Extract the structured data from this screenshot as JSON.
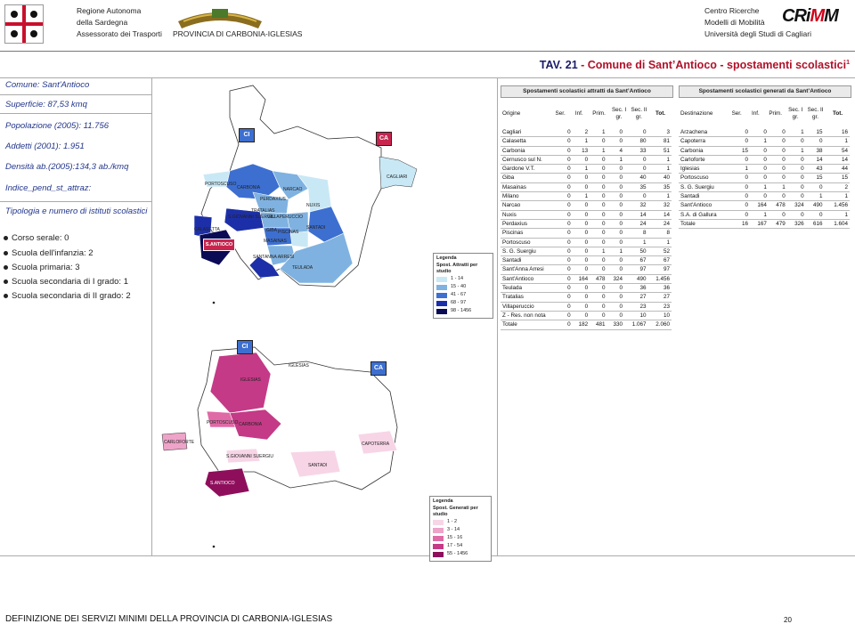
{
  "header": {
    "left": [
      "Regione Autonoma",
      "della Sardegna",
      "Assessorato dei Trasporti"
    ],
    "province": "PROVINCIA DI CARBONIA-IGLESIAS",
    "right": [
      "Centro Ricerche",
      "Modelli di Mobilità",
      "Università degli Studi di Cagliari"
    ],
    "logo": {
      "pre": "CRi",
      "mid": "M",
      "post": "M"
    }
  },
  "title": {
    "prefix": "TAV. 21",
    "text": " - Comune di Sant’Antioco - spostamenti scolastici",
    "sup": "1"
  },
  "left_panel": {
    "comune": "Comune: Sant'Antioco",
    "superficie": "Superficie: 87,53 kmq",
    "popolazione": "Popolazione (2005): 11.756",
    "addetti": "Addetti (2001): 1.951",
    "densita": "Densità ab.(2005):134,3 ab./kmq",
    "indice": "Indice_pend_st_attraz:",
    "tipologia": "Tipologia e numero di istituti scolastici",
    "istituti": [
      "Corso serale: 0",
      "Scuola dell'infanzia: 2",
      "Scuola primaria: 3",
      "Scuola secondaria di I grado: 1",
      "Scuola secondaria di II grado: 2"
    ]
  },
  "tables": {
    "attratti": {
      "title": "Spostamenti scolastici attratti da Sant’Antioco",
      "headers": [
        "Origine",
        "Ser.",
        "Inf.",
        "Prim.",
        "Sec. I gr.",
        "Sec. II gr.",
        "Tot."
      ],
      "rows": [
        [
          "Cagliari",
          "0",
          "2",
          "1",
          "0",
          "0",
          "3"
        ],
        [
          "Calasetta",
          "0",
          "1",
          "0",
          "0",
          "80",
          "81"
        ],
        [
          "Carbonia",
          "0",
          "13",
          "1",
          "4",
          "33",
          "51"
        ],
        [
          "Cernusco sul N.",
          "0",
          "0",
          "0",
          "1",
          "0",
          "1"
        ],
        [
          "Gardone V.T.",
          "0",
          "1",
          "0",
          "0",
          "0",
          "1"
        ],
        [
          "Giba",
          "0",
          "0",
          "0",
          "0",
          "40",
          "40"
        ],
        [
          "Masainas",
          "0",
          "0",
          "0",
          "0",
          "35",
          "35"
        ],
        [
          "Milano",
          "0",
          "1",
          "0",
          "0",
          "0",
          "1"
        ],
        [
          "Narcao",
          "0",
          "0",
          "0",
          "0",
          "32",
          "32"
        ],
        [
          "Nuxis",
          "0",
          "0",
          "0",
          "0",
          "14",
          "14"
        ],
        [
          "Perdaxius",
          "0",
          "0",
          "0",
          "0",
          "24",
          "24"
        ],
        [
          "Piscinas",
          "0",
          "0",
          "0",
          "0",
          "8",
          "8"
        ],
        [
          "Portoscuso",
          "0",
          "0",
          "0",
          "0",
          "1",
          "1"
        ],
        [
          "S. G. Suergiu",
          "0",
          "0",
          "1",
          "1",
          "50",
          "52"
        ],
        [
          "Santadi",
          "0",
          "0",
          "0",
          "0",
          "67",
          "67"
        ],
        [
          "Sant'Anna Arresi",
          "0",
          "0",
          "0",
          "0",
          "97",
          "97"
        ],
        [
          "Sant'Antioco",
          "0",
          "164",
          "478",
          "324",
          "490",
          "1.456"
        ],
        [
          "Teulada",
          "0",
          "0",
          "0",
          "0",
          "36",
          "36"
        ],
        [
          "Tratalias",
          "0",
          "0",
          "0",
          "0",
          "27",
          "27"
        ],
        [
          "Villaperuccio",
          "0",
          "0",
          "0",
          "0",
          "23",
          "23"
        ],
        [
          "Z - Res. non nota",
          "0",
          "0",
          "0",
          "0",
          "10",
          "10"
        ],
        [
          "Totale",
          "0",
          "182",
          "481",
          "330",
          "1.067",
          "2.060"
        ]
      ]
    },
    "generati": {
      "title": "Spostamenti scolastici generati da Sant’Antioco",
      "headers": [
        "Destinazione",
        "Ser.",
        "Inf.",
        "Prim.",
        "Sec. I gr.",
        "Sec. II gr.",
        "Tot."
      ],
      "rows": [
        [
          "Arzachena",
          "0",
          "0",
          "0",
          "1",
          "15",
          "16"
        ],
        [
          "Capoterra",
          "0",
          "1",
          "0",
          "0",
          "0",
          "1"
        ],
        [
          "Carbonia",
          "15",
          "0",
          "0",
          "1",
          "38",
          "54"
        ],
        [
          "Carloforte",
          "0",
          "0",
          "0",
          "0",
          "14",
          "14"
        ],
        [
          "Iglesias",
          "1",
          "0",
          "0",
          "0",
          "43",
          "44"
        ],
        [
          "Portoscuso",
          "0",
          "0",
          "0",
          "0",
          "15",
          "15"
        ],
        [
          "S. G. Suergiu",
          "0",
          "1",
          "1",
          "0",
          "0",
          "2"
        ],
        [
          "Santadi",
          "0",
          "0",
          "0",
          "0",
          "1",
          "1"
        ],
        [
          "Sant'Antioco",
          "0",
          "164",
          "478",
          "324",
          "490",
          "1.456"
        ],
        [
          "S.A. di Gallura",
          "0",
          "1",
          "0",
          "0",
          "0",
          "1"
        ],
        [
          "Totale",
          "16",
          "167",
          "479",
          "326",
          "616",
          "1.604"
        ]
      ]
    }
  },
  "map_top": {
    "tag_ci": "CI",
    "tag_ca": "CA",
    "labels": [
      "PORTOSCUSO",
      "CARBONIA",
      "NARCAO",
      "NUXIS",
      "PERDAXIUS",
      "TRATALIAS",
      "S.GIOVANNI SUERGIU",
      "VILLAPERUCCIO",
      "SANTADI",
      "GIBA",
      "PISCINAS",
      "CALASETTA",
      "S.ANTIOCO",
      "MASAINAS",
      "SANTANNA ARRESI",
      "TEULADA",
      "CAGLIARI"
    ],
    "legend": {
      "title1": "Legenda",
      "title2": "Spost. Attratti per studio",
      "classes": [
        {
          "label": "1 - 14",
          "color": "#c9e8f5"
        },
        {
          "label": "15 - 40",
          "color": "#7fb2e0"
        },
        {
          "label": "41 - 67",
          "color": "#3d6fd0"
        },
        {
          "label": "68 - 97",
          "color": "#1c2fa8"
        },
        {
          "label": "98 - 1456",
          "color": "#0a0a55"
        }
      ]
    }
  },
  "map_bottom": {
    "tag_ci": "CI",
    "tag_ca": "CA",
    "labels": [
      "IGLESIAS",
      "IGLESIAS",
      "PORTOSCUSO",
      "CARBONIA",
      "CARLOFORTE",
      "S.GIOVANNI SUERGIU",
      "SANTADI",
      "CAPOTERRA",
      "S.ANTIOCO"
    ],
    "legend": {
      "title1": "Legenda",
      "title2": "Spost. Generati per studio",
      "classes": [
        {
          "label": "1 - 2",
          "color": "#f7d5e6"
        },
        {
          "label": "3 - 14",
          "color": "#eea3c8"
        },
        {
          "label": "15 - 16",
          "color": "#df6aa6"
        },
        {
          "label": "17 - 54",
          "color": "#c43a87"
        },
        {
          "label": "55 - 1456",
          "color": "#8e0e5c"
        }
      ]
    }
  },
  "footer": {
    "text": "DEFINIZIONE DEI SERVIZI MINIMI DELLA PROVINCIA DI CARBONIA-IGLESIAS",
    "page": "20"
  }
}
